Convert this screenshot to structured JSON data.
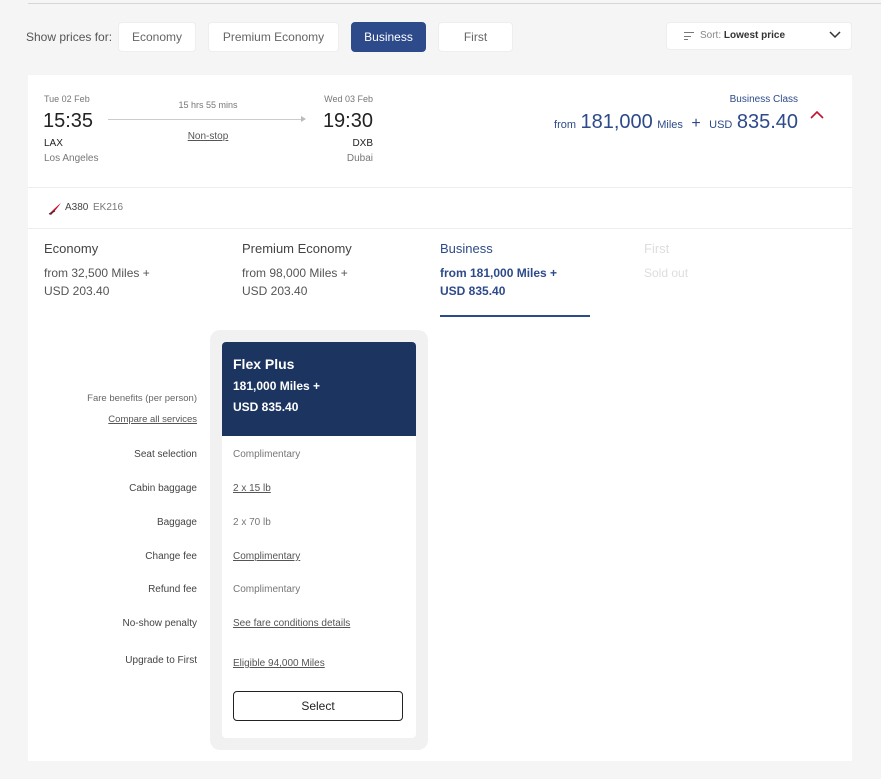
{
  "filters": {
    "label": "Show prices for:",
    "cabins": [
      "Economy",
      "Premium Economy",
      "Business",
      "First"
    ],
    "active": "Business",
    "sort_label": "Sort:",
    "sort_value": "Lowest price"
  },
  "flight": {
    "departure": {
      "date": "Tue 02 Feb",
      "time": "15:35",
      "code": "LAX",
      "city": "Los Angeles"
    },
    "duration": "15 hrs 55 mins",
    "stops": "Non-stop",
    "arrival": {
      "date": "Wed 03 Feb",
      "time": "19:30",
      "code": "DXB",
      "city": "Dubai"
    },
    "class_label": "Business Class",
    "price": {
      "from": "from",
      "miles": "181,000",
      "miles_unit": "Miles",
      "plus": "+",
      "currency": "USD",
      "amount": "835.40"
    },
    "aircraft": "A380",
    "flight_number": "EK216"
  },
  "cabin_tabs": [
    {
      "name": "Economy",
      "line1": "from  32,500 Miles  +",
      "line2": "USD  203.40"
    },
    {
      "name": "Premium Economy",
      "line1": "from  98,000 Miles  +",
      "line2": "USD  203.40"
    },
    {
      "name": "Business",
      "line1": "from  181,000 Miles  +",
      "line2": "USD  835.40"
    },
    {
      "name": "First",
      "line1": "Sold out",
      "line2": ""
    }
  ],
  "fare_labels": {
    "benefits": "Fare benefits (per person)",
    "compare": "Compare all services",
    "rows": [
      "Seat selection",
      "Cabin baggage",
      "Baggage",
      "Change fee",
      "Refund fee",
      "No-show penalty",
      "Upgrade to First"
    ]
  },
  "fare": {
    "name": "Flex Plus",
    "miles": "181,000 Miles  +",
    "usd": "USD 835.40",
    "values": [
      "Complimentary",
      "2 x 15 lb",
      "2 x 70 lb",
      "Complimentary",
      "Complimentary",
      "See fare conditions details",
      "Eligible 94,000 Miles"
    ],
    "select_label": "Select"
  },
  "colors": {
    "brand_blue": "#2d4a8a",
    "fare_header": "#1c3460",
    "accent_red": "#c8102e"
  }
}
